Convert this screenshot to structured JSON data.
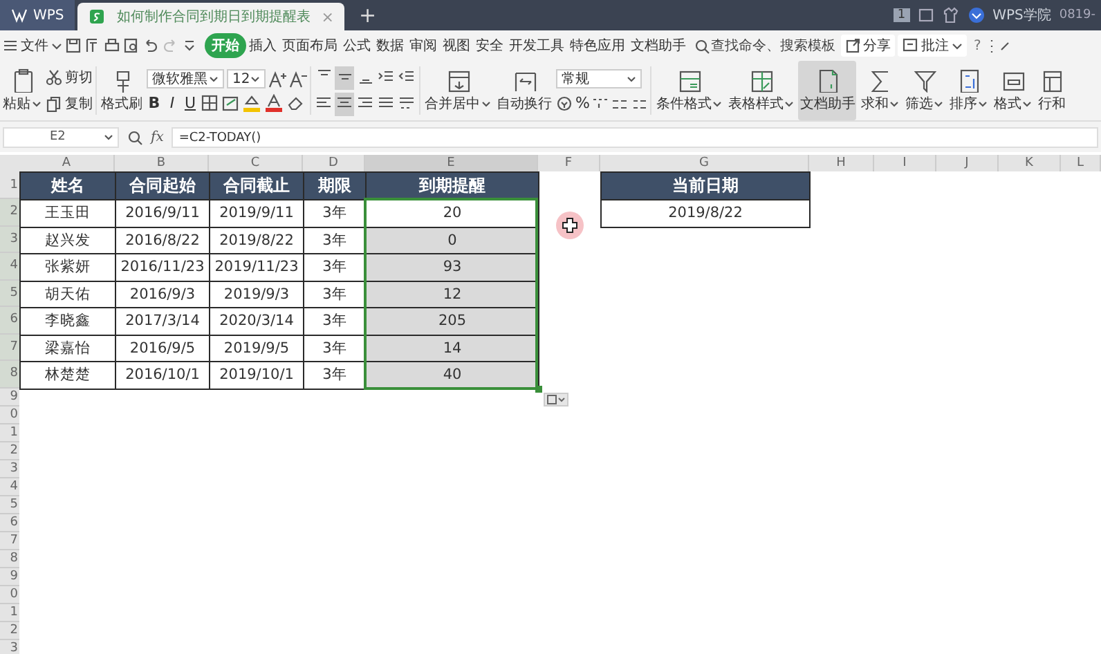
{
  "title_bar": {
    "tabs": [
      {
        "label": "WPS",
        "kind": "home",
        "selected": false
      },
      {
        "label": "如何制作合同到期日到期提醒表",
        "kind": "document",
        "selected": true
      }
    ],
    "close": "×",
    "new_tab": "+",
    "badge": "1",
    "account": "WPS学院",
    "clock": "0819-"
  },
  "menu": {
    "file": "文件",
    "tabs": [
      {
        "label": "开始",
        "selected": true
      },
      {
        "label": "插入",
        "selected": false
      },
      {
        "label": "页面布局",
        "selected": false
      },
      {
        "label": "公式",
        "selected": false
      },
      {
        "label": "数据",
        "selected": false
      },
      {
        "label": "审阅",
        "selected": false
      },
      {
        "label": "视图",
        "selected": false
      },
      {
        "label": "安全",
        "selected": false
      },
      {
        "label": "开发工具",
        "selected": false
      },
      {
        "label": "特色应用",
        "selected": false
      },
      {
        "label": "文档助手",
        "selected": false
      }
    ],
    "search": {
      "placeholder": "查找命令、搜索模板"
    },
    "share": "分享",
    "comment": "批注",
    "help": "?"
  },
  "ribbon": {
    "groups": [
      {
        "kind": "big",
        "label": "粘贴",
        "dropdown": true,
        "selected": false
      },
      {
        "kind": "pair",
        "items": [
          "剪切",
          "复制"
        ]
      },
      {
        "kind": "big",
        "label": "格式刷",
        "dropdown": false,
        "selected": false
      },
      {
        "kind": "font",
        "font": "微软雅黑",
        "size": "12",
        "styles": [
          "B",
          "I",
          "U"
        ]
      },
      {
        "kind": "align",
        "buttons": [
          {
            "selected": false
          },
          {
            "selected": true
          },
          {
            "selected": false
          },
          {
            "selected": false
          },
          {
            "selected": false
          },
          {
            "selected": false
          },
          {
            "selected": true
          },
          {
            "selected": false
          },
          {
            "selected": false
          },
          {
            "selected": false
          }
        ]
      },
      {
        "kind": "big",
        "label": "合并居中",
        "dropdown": true,
        "selected": false
      },
      {
        "kind": "big",
        "label": "自动换行",
        "dropdown": false,
        "selected": false
      },
      {
        "kind": "number",
        "format": "常规",
        "percent": "%"
      },
      {
        "kind": "big",
        "label": "条件格式",
        "dropdown": true,
        "selected": false
      },
      {
        "kind": "big",
        "label": "表格样式",
        "dropdown": true,
        "selected": false
      },
      {
        "kind": "big",
        "label": "文档助手",
        "dropdown": false,
        "selected": true
      },
      {
        "kind": "big",
        "label": "求和",
        "dropdown": true,
        "selected": false
      },
      {
        "kind": "big",
        "label": "筛选",
        "dropdown": true,
        "selected": false
      },
      {
        "kind": "big",
        "label": "排序",
        "dropdown": true,
        "selected": false
      },
      {
        "kind": "big",
        "label": "格式",
        "dropdown": true,
        "selected": false
      },
      {
        "kind": "big",
        "label": "行和",
        "dropdown": false,
        "selected": false
      }
    ]
  },
  "formula_bar": {
    "cell_ref": "E2",
    "fx": "fx",
    "formula": "=C2-TODAY()"
  },
  "sheet": {
    "columns": [
      {
        "label": "A",
        "selected": false
      },
      {
        "label": "B",
        "selected": false
      },
      {
        "label": "C",
        "selected": false
      },
      {
        "label": "D",
        "selected": false
      },
      {
        "label": "E",
        "selected": true
      },
      {
        "label": "F",
        "selected": false
      },
      {
        "label": "G",
        "selected": false
      },
      {
        "label": "H",
        "selected": false
      },
      {
        "label": "I",
        "selected": false
      },
      {
        "label": "J",
        "selected": false
      },
      {
        "label": "K",
        "selected": false
      },
      {
        "label": "L",
        "selected": false
      }
    ],
    "row_headers": [
      {
        "label": "1",
        "selected": false
      },
      {
        "label": "2",
        "selected": true
      },
      {
        "label": "3",
        "selected": true
      },
      {
        "label": "4",
        "selected": true
      },
      {
        "label": "5",
        "selected": true
      },
      {
        "label": "6",
        "selected": true
      },
      {
        "label": "7",
        "selected": true
      },
      {
        "label": "8",
        "selected": true
      },
      {
        "label": "9",
        "selected": false
      },
      {
        "label": "0",
        "selected": false
      },
      {
        "label": "1",
        "selected": false
      },
      {
        "label": "2",
        "selected": false
      },
      {
        "label": "3",
        "selected": false
      },
      {
        "label": "4",
        "selected": false
      },
      {
        "label": "5",
        "selected": false
      },
      {
        "label": "6",
        "selected": false
      },
      {
        "label": "7",
        "selected": false
      },
      {
        "label": "8",
        "selected": false
      },
      {
        "label": "9",
        "selected": false
      },
      {
        "label": "0",
        "selected": false
      },
      {
        "label": "1",
        "selected": false
      },
      {
        "label": "2",
        "selected": false
      },
      {
        "label": "3",
        "selected": false
      }
    ],
    "table": {
      "columns": [
        "姓名",
        "合同起始",
        "合同截止",
        "期限",
        "到期提醒"
      ],
      "rows": [
        {
          "cells": [
            "王玉田",
            "2016/9/11",
            "2019/9/11",
            "3年"
          ],
          "reminder": {
            "text": "20",
            "active": true,
            "selected": false
          }
        },
        {
          "cells": [
            "赵兴发",
            "2016/8/22",
            "2019/8/22",
            "3年"
          ],
          "reminder": {
            "text": "0",
            "active": false,
            "selected": true
          }
        },
        {
          "cells": [
            "张紫妍",
            "2016/11/23",
            "2019/11/23",
            "3年"
          ],
          "reminder": {
            "text": "93",
            "active": false,
            "selected": true
          }
        },
        {
          "cells": [
            "胡天佑",
            "2016/9/3",
            "2019/9/3",
            "3年"
          ],
          "reminder": {
            "text": "12",
            "active": false,
            "selected": true
          }
        },
        {
          "cells": [
            "李晓鑫",
            "2017/3/14",
            "2020/3/14",
            "3年"
          ],
          "reminder": {
            "text": "205",
            "active": false,
            "selected": true
          }
        },
        {
          "cells": [
            "梁嘉怡",
            "2016/9/5",
            "2019/9/5",
            "3年"
          ],
          "reminder": {
            "text": "14",
            "active": false,
            "selected": true
          }
        },
        {
          "cells": [
            "林楚楚",
            "2016/10/1",
            "2019/10/1",
            "3年"
          ],
          "reminder": {
            "text": "40",
            "active": false,
            "selected": true
          }
        }
      ]
    },
    "current_date": {
      "header": "当前日期",
      "value": "2019/8/22"
    }
  }
}
